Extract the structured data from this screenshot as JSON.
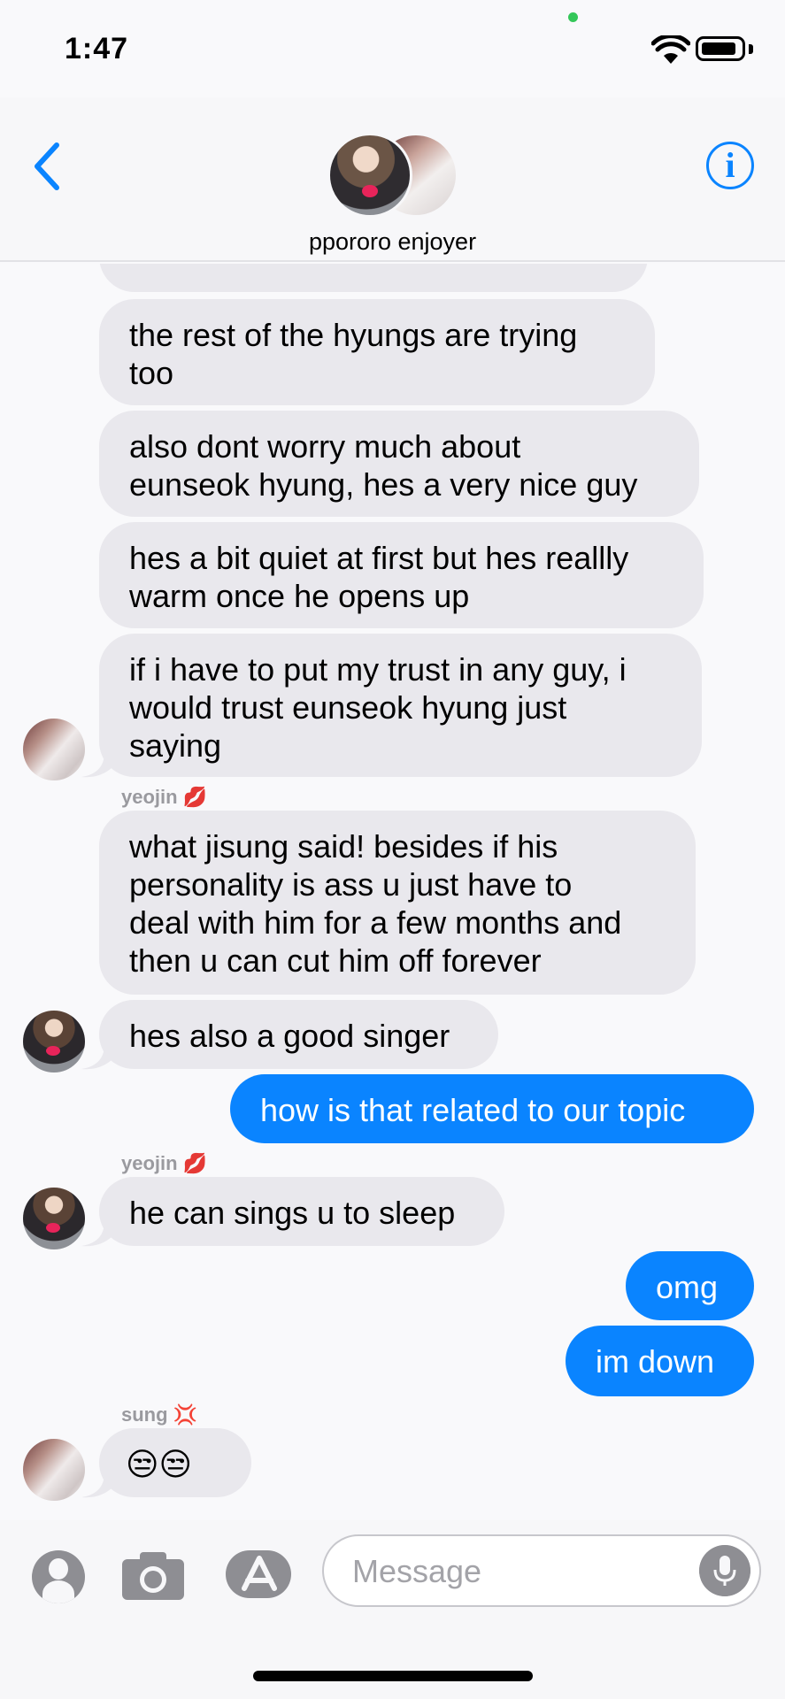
{
  "status_bar": {
    "time": "1:47"
  },
  "header": {
    "title": "ppororo enjoyer"
  },
  "messages": [
    {
      "side": "in",
      "text": "the rest of the hyungs are trying\ntoo"
    },
    {
      "side": "in",
      "text": "also dont worry much about\neunseok hyung, hes a very nice guy"
    },
    {
      "side": "in",
      "text": "hes a bit quiet at first but hes reallly\nwarm once he opens up"
    },
    {
      "side": "in",
      "text": "if i have to put my trust in any guy, i\nwould trust eunseok hyung just\nsaying"
    },
    {
      "side": "sender",
      "text": "yeojin 💋"
    },
    {
      "side": "in",
      "text": "what jisung said! besides if his\npersonality is ass u just have to\ndeal with him for a few months and\nthen u can cut him off forever"
    },
    {
      "side": "in",
      "text": "hes also a good singer"
    },
    {
      "side": "out",
      "text": "how is that related to our topic"
    },
    {
      "side": "sender",
      "text": "yeojin 💋"
    },
    {
      "side": "in",
      "text": "he can sings u to sleep"
    },
    {
      "side": "out",
      "text": "omg"
    },
    {
      "side": "out",
      "text": "im down"
    },
    {
      "side": "sender",
      "text": "sung 💢"
    },
    {
      "side": "in",
      "text": "😒😒"
    }
  ],
  "input_bar": {
    "placeholder": "Message"
  },
  "colors": {
    "accent": "#0a84ff",
    "incoming_bubble": "#e9e8ed",
    "outgoing_text": "#ffffff"
  },
  "icons": [
    "back-chevron-icon",
    "info-icon",
    "contact-icon",
    "camera-icon",
    "app-store-icon",
    "microphone-icon"
  ]
}
